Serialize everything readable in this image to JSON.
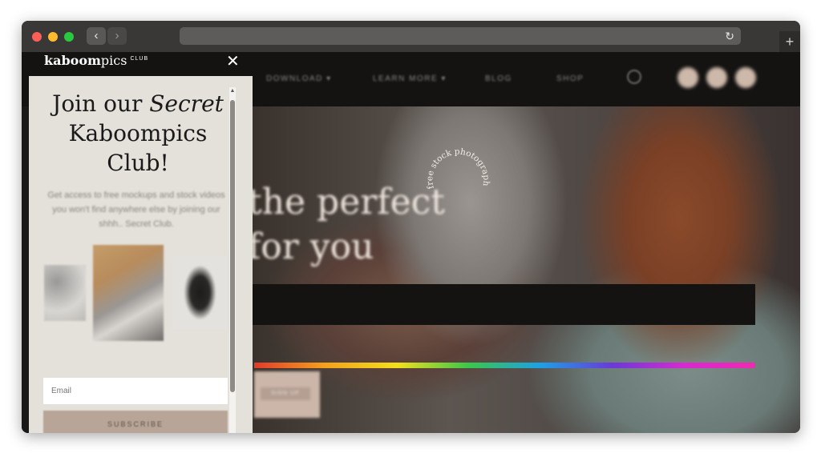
{
  "browser": {
    "back_icon": "chevron-left-icon",
    "forward_icon": "chevron-right-icon",
    "back_glyph": "‹",
    "forward_glyph": "›",
    "reload_glyph": "↻",
    "newtab_glyph": "+",
    "address": ""
  },
  "site": {
    "nav": [
      "DOWNLOAD ▾",
      "LEARN MORE ▾",
      "BLOG",
      "SHOP"
    ],
    "headline_line1": "the perfect",
    "headline_line2": "for you",
    "badge_text": "free stock photography",
    "hero_button": "SIGN UP"
  },
  "popup": {
    "logo_main": "kaboom",
    "logo_rest": "pics",
    "logo_tag": "CLUB",
    "close_glyph": "✕",
    "title_part1": "Join our ",
    "title_em": "Secret",
    "title_part2": "Kaboompics Club!",
    "description": "Get access to free mockups and stock videos you won't find anywhere else by joining our shhh.. Secret Club.",
    "email_placeholder": "Email",
    "subscribe_label": "SUBSCRIBE"
  },
  "colors": {
    "close_red": "#ff5f57",
    "minimize_yellow": "#febc2e",
    "zoom_green": "#28c840",
    "nav_dark": "#141312",
    "popup_bg": "#e4e0da",
    "accent_taupe": "#b8a597"
  }
}
